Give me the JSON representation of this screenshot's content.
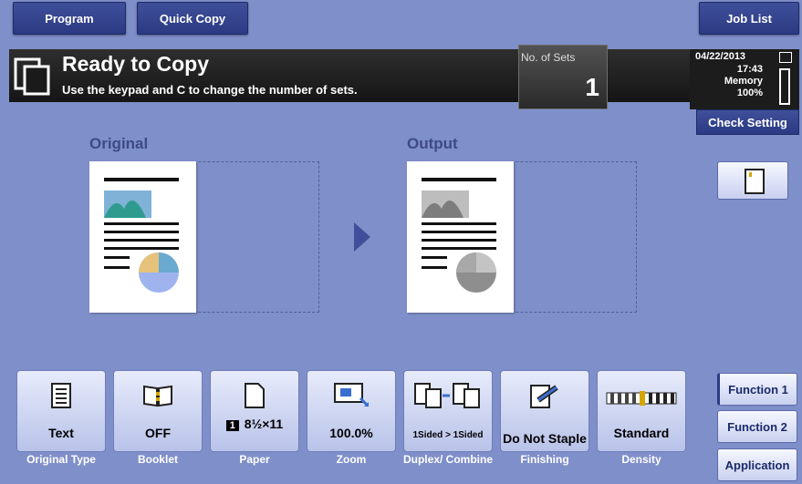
{
  "tabs": {
    "program": "Program",
    "quick_copy": "Quick Copy",
    "job_list": "Job List"
  },
  "status": {
    "title": "Ready to Copy",
    "subtitle": "Use the keypad and C to change the number of sets."
  },
  "sets": {
    "label": "No. of Sets",
    "value": "1"
  },
  "info": {
    "date": "04/22/2013",
    "time": "17:43",
    "memory_label": "Memory",
    "memory_pct": "100%"
  },
  "check_setting": "Check Setting",
  "preview": {
    "original_label": "Original",
    "output_label": "Output"
  },
  "tiles": [
    {
      "value": "Text",
      "caption": "Original Type",
      "icon": "document-lines-icon"
    },
    {
      "value": "OFF",
      "caption": "Booklet",
      "icon": "booklet-icon"
    },
    {
      "value": "8½×11",
      "caption": "Paper",
      "icon": "paper-icon",
      "tray": "1"
    },
    {
      "value": "100.0%",
      "caption": "Zoom",
      "icon": "zoom-icon"
    },
    {
      "value": "1Sided > 1Sided",
      "caption": "Duplex/ Combine",
      "icon": "duplex-icon"
    },
    {
      "value": "Do Not Staple",
      "caption": "Finishing",
      "icon": "staple-icon"
    },
    {
      "value": "Standard",
      "caption": "Density",
      "icon": "density-icon"
    }
  ],
  "functions": {
    "function1": "Function 1",
    "function2": "Function 2",
    "application": "Application"
  },
  "colors": {
    "background": "#7f8fc9",
    "tab": "#2b3a83",
    "statusbar": "#1a1a1a"
  }
}
